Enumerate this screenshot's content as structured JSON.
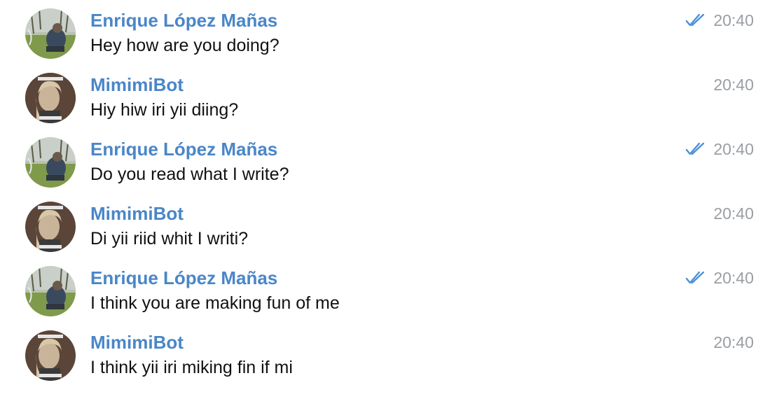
{
  "messages": [
    {
      "sender": "Enrique López Mañas",
      "text": "Hey how are you doing?",
      "time": "20:40",
      "read_icon": "double-check-icon",
      "avatar": "enrique"
    },
    {
      "sender": "MimimiBot",
      "text": "Hiy hiw iri yii diing?",
      "time": "20:40",
      "read_icon": null,
      "avatar": "bot"
    },
    {
      "sender": "Enrique López Mañas",
      "text": "Do you read what I write?",
      "time": "20:40",
      "read_icon": "double-check-icon",
      "avatar": "enrique"
    },
    {
      "sender": "MimimiBot",
      "text": "Di yii riid whit I writi?",
      "time": "20:40",
      "read_icon": null,
      "avatar": "bot"
    },
    {
      "sender": "Enrique López Mañas",
      "text": "I think you are making fun of me",
      "time": "20:40",
      "read_icon": "double-check-icon",
      "avatar": "enrique"
    },
    {
      "sender": "MimimiBot",
      "text": "I think yii iri miking fin if mi",
      "time": "20:40",
      "read_icon": null,
      "avatar": "bot"
    }
  ],
  "colors": {
    "sender": "#4a86c8",
    "check": "#4a90d9",
    "time": "#9a9ea3",
    "text": "#111111"
  }
}
